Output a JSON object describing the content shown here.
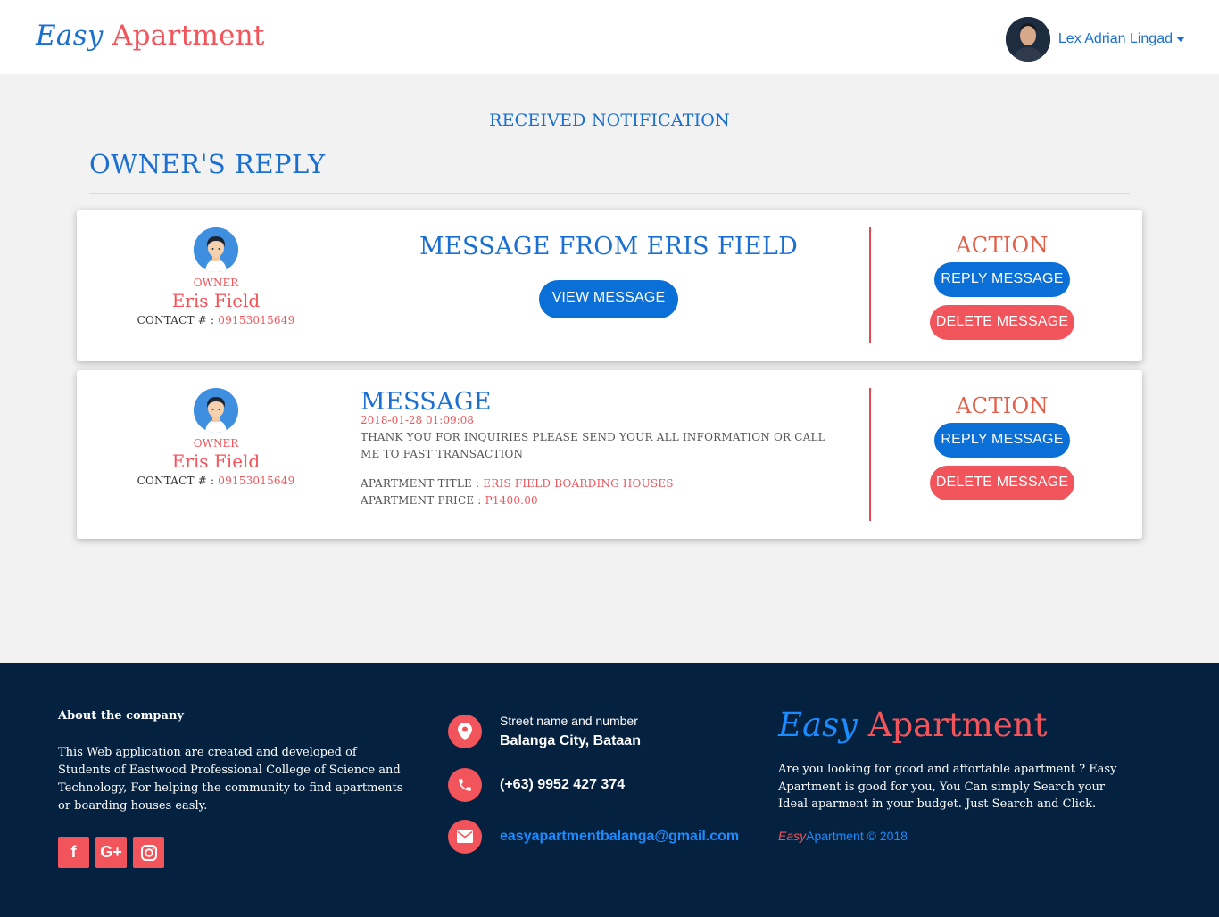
{
  "header": {
    "brand_part1": "Easy",
    "brand_part2": "Apartment",
    "user_name": "Lex Adrian Lingad"
  },
  "page": {
    "notification_title": "RECEIVED NOTIFICATION",
    "section_title": "OWNER'S REPLY"
  },
  "cards": [
    {
      "owner_role": "OWNER",
      "owner_name": "Eris Field",
      "contact_label": "CONTACT # : ",
      "contact_number": "09153015649",
      "message_from": "MESSAGE FROM ERIS FIELD",
      "view_button": "VIEW MESSAGE",
      "action_title": "ACTION",
      "reply_button": "REPLY MESSAGE",
      "delete_button": "DELETE MESSAGE"
    },
    {
      "owner_role": "OWNER",
      "owner_name": "Eris Field",
      "contact_label": "CONTACT # : ",
      "contact_number": "09153015649",
      "message_heading": "MESSAGE",
      "message_date": "2018-01-28 01:09:08",
      "message_body": "THANK YOU FOR INQUIRIES PLEASE SEND YOUR ALL INFORMATION OR CALL ME TO FAST TRANSACTION",
      "apartment_title_label": "APARTMENT TITLE : ",
      "apartment_title": "ERIS FIELD BOARDING HOUSES",
      "apartment_price_label": "APARTMENT PRICE : ",
      "apartment_price": "P1400.00",
      "action_title": "ACTION",
      "reply_button": "REPLY MESSAGE",
      "delete_button": "DELETE MESSAGE"
    }
  ],
  "footer": {
    "about_heading": "About the company",
    "about_text": "This Web application are created and developed of Students of Eastwood Professional College of Science and Technology, For helping the community to find apartments or boarding houses easly.",
    "socials": [
      {
        "icon": "facebook-icon",
        "glyph": "f"
      },
      {
        "icon": "google-plus-icon",
        "glyph": "G+"
      },
      {
        "icon": "instagram-icon",
        "glyph": "◎"
      }
    ],
    "address_small": "Street name and number",
    "address_big": "Balanga City, Bataan",
    "phone": "(+63) 9952 427 374",
    "email": "easyapartmentbalanga@gmail.com",
    "brand_part1": "Easy",
    "brand_part2": "Apartment",
    "description": "Are you looking for good and affortable apartment ? Easy Apartment is good for you, You Can simply Search your Ideal aparment in your budget. Just Search and Click.",
    "copyright_part1": "Easy",
    "copyright_part2": "Apartment © 2018"
  },
  "colors": {
    "primary_blue": "#1a6fd1",
    "accent_red": "#f2545b",
    "footer_bg": "#04213f"
  }
}
